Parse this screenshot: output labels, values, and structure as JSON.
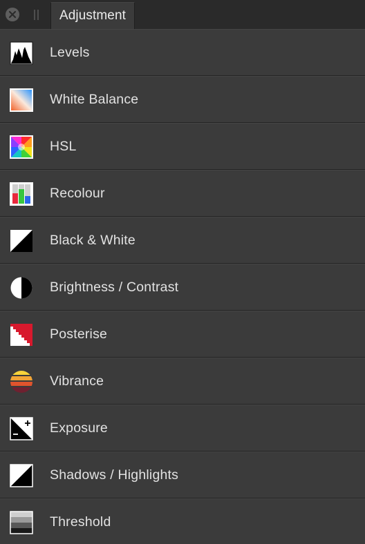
{
  "panel": {
    "tab_title": "Adjustment"
  },
  "adjustments": [
    {
      "label": "Levels",
      "icon": "levels-icon"
    },
    {
      "label": "White Balance",
      "icon": "white-balance-icon"
    },
    {
      "label": "HSL",
      "icon": "hsl-icon"
    },
    {
      "label": "Recolour",
      "icon": "recolour-icon"
    },
    {
      "label": "Black & White",
      "icon": "black-white-icon"
    },
    {
      "label": "Brightness / Contrast",
      "icon": "brightness-contrast-icon"
    },
    {
      "label": "Posterise",
      "icon": "posterise-icon"
    },
    {
      "label": "Vibrance",
      "icon": "vibrance-icon"
    },
    {
      "label": "Exposure",
      "icon": "exposure-icon"
    },
    {
      "label": "Shadows / Highlights",
      "icon": "shadows-highlights-icon"
    },
    {
      "label": "Threshold",
      "icon": "threshold-icon"
    }
  ]
}
